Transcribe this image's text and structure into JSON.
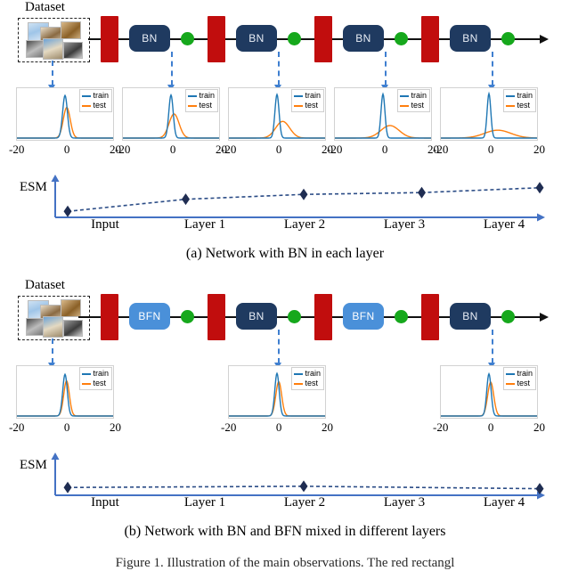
{
  "figure": {
    "caption_a": "(a) Network with BN in each layer",
    "caption_b": "(b) Network with BN and BFN mixed in different layers",
    "bottom_caption": "Figure 1.  Illustration of the main observations.  The red rectangl",
    "dataset_label": "Dataset",
    "esm_label": "ESM",
    "colors": {
      "conv_block": "#c10d0d",
      "bn_block": "#1f3a60",
      "bfn_block": "#4a90d9",
      "activation_dot": "#16a81c",
      "train_curve": "#1f77b4",
      "test_curve": "#ff7f0e",
      "connector": "#3f7fd0",
      "esm_axis": "#4472c4",
      "esm_marker": "#1f2d52"
    }
  },
  "panel_a": {
    "blocks": [
      {
        "type": "conv",
        "label": ""
      },
      {
        "type": "norm",
        "label": "BN"
      },
      {
        "type": "act",
        "label": ""
      },
      {
        "type": "conv",
        "label": ""
      },
      {
        "type": "norm",
        "label": "BN"
      },
      {
        "type": "act",
        "label": ""
      },
      {
        "type": "conv",
        "label": ""
      },
      {
        "type": "norm",
        "label": "BN"
      },
      {
        "type": "act",
        "label": ""
      },
      {
        "type": "conv",
        "label": ""
      },
      {
        "type": "norm",
        "label": "BN"
      },
      {
        "type": "act",
        "label": ""
      }
    ],
    "distributions": [
      {
        "legend_train": "train",
        "legend_test": "test",
        "xticks": [
          "-20",
          "0",
          "20"
        ],
        "train": {
          "mean": 0.0,
          "sd": 1.1,
          "peak": 0.92
        },
        "test": {
          "mean": 0.8,
          "sd": 1.6,
          "peak": 0.66
        }
      },
      {
        "legend_train": "train",
        "legend_test": "test",
        "xticks": [
          "-20",
          "0",
          "20"
        ],
        "train": {
          "mean": 0.0,
          "sd": 1.0,
          "peak": 0.93
        },
        "test": {
          "mean": 1.4,
          "sd": 2.3,
          "peak": 0.52
        }
      },
      {
        "legend_train": "train",
        "legend_test": "test",
        "xticks": [
          "-20",
          "0",
          "20"
        ],
        "train": {
          "mean": 0.0,
          "sd": 0.95,
          "peak": 0.94
        },
        "test": {
          "mean": 2.6,
          "sd": 3.2,
          "peak": 0.36
        }
      },
      {
        "legend_train": "train",
        "legend_test": "test",
        "xticks": [
          "-20",
          "0",
          "20"
        ],
        "train": {
          "mean": 0.0,
          "sd": 0.9,
          "peak": 0.95
        },
        "test": {
          "mean": 3.2,
          "sd": 4.2,
          "peak": 0.27
        }
      },
      {
        "legend_train": "train",
        "legend_test": "test",
        "xticks": [
          "-20",
          "0",
          "20"
        ],
        "train": {
          "mean": 0.0,
          "sd": 0.85,
          "peak": 0.96
        },
        "test": {
          "mean": 4.0,
          "sd": 6.0,
          "peak": 0.17
        }
      }
    ],
    "chart_data": {
      "type": "line",
      "title": "",
      "xlabel": "",
      "ylabel": "ESM",
      "categories": [
        "Input",
        "Layer 1",
        "Layer 2",
        "Layer 3",
        "Layer 4"
      ],
      "values": [
        0.08,
        0.48,
        0.64,
        0.7,
        0.86
      ],
      "ylim": [
        0,
        1
      ],
      "grid": false,
      "legend": "none",
      "markers": "diamond",
      "linestyle": "dashed"
    }
  },
  "panel_b": {
    "blocks": [
      {
        "type": "conv",
        "label": ""
      },
      {
        "type": "norm",
        "label": "BFN"
      },
      {
        "type": "act",
        "label": ""
      },
      {
        "type": "conv",
        "label": ""
      },
      {
        "type": "norm",
        "label": "BN"
      },
      {
        "type": "act",
        "label": ""
      },
      {
        "type": "conv",
        "label": ""
      },
      {
        "type": "norm",
        "label": "BFN"
      },
      {
        "type": "act",
        "label": ""
      },
      {
        "type": "conv",
        "label": ""
      },
      {
        "type": "norm",
        "label": "BN"
      },
      {
        "type": "act",
        "label": ""
      }
    ],
    "distributions": [
      {
        "legend_train": "train",
        "legend_test": "test",
        "xticks": [
          "-20",
          "0",
          "20"
        ],
        "train": {
          "mean": 0.0,
          "sd": 1.05,
          "peak": 0.9
        },
        "test": {
          "mean": 0.7,
          "sd": 1.3,
          "peak": 0.76
        }
      },
      {
        "legend_train": "train",
        "legend_test": "test",
        "xticks": [
          "-20",
          "0",
          "20"
        ],
        "train": {
          "mean": 0.0,
          "sd": 1.0,
          "peak": 0.92
        },
        "test": {
          "mean": 0.8,
          "sd": 1.35,
          "peak": 0.74
        }
      },
      {
        "legend_train": "train",
        "legend_test": "test",
        "xticks": [
          "-20",
          "0",
          "20"
        ],
        "train": {
          "mean": 0.0,
          "sd": 1.0,
          "peak": 0.91
        },
        "test": {
          "mean": 0.8,
          "sd": 1.4,
          "peak": 0.73
        }
      }
    ],
    "chart_data": {
      "type": "line",
      "title": "",
      "xlabel": "",
      "ylabel": "ESM",
      "categories": [
        "Input",
        "Layer 1",
        "Layer 2",
        "Layer 3",
        "Layer 4"
      ],
      "values": [
        0.14,
        null,
        0.18,
        null,
        0.1
      ],
      "ylim": [
        0,
        1
      ],
      "grid": false,
      "legend": "none",
      "markers": "diamond",
      "linestyle": "dashed"
    }
  }
}
